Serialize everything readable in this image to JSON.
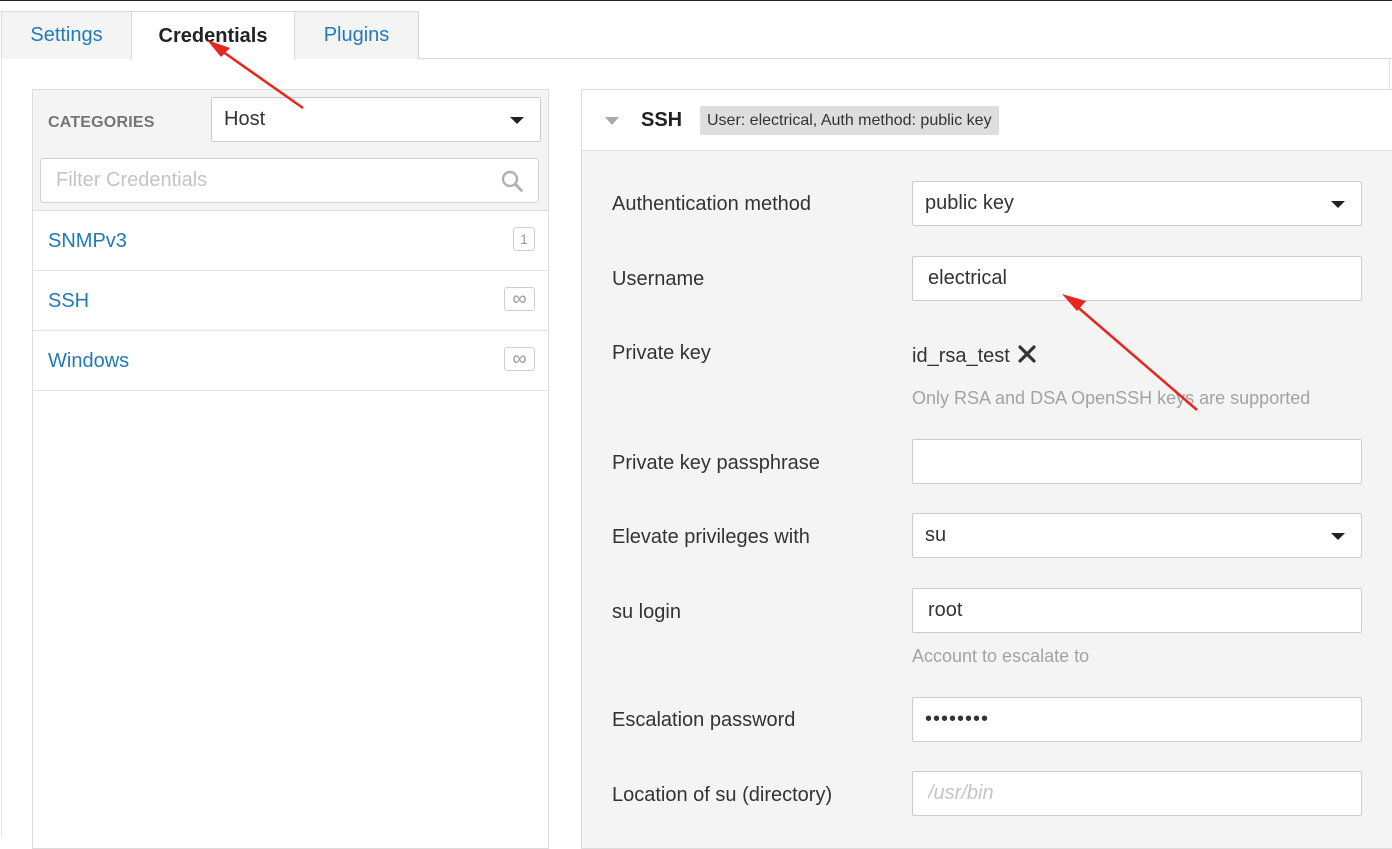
{
  "tabs": [
    {
      "label": "Settings",
      "active": false
    },
    {
      "label": "Credentials",
      "active": true
    },
    {
      "label": "Plugins",
      "active": false
    }
  ],
  "left": {
    "categories_label": "CATEGORIES",
    "category_value": "Host",
    "filter_placeholder": "Filter Credentials",
    "items": [
      {
        "name": "SNMPv3",
        "count": "1"
      },
      {
        "name": "SSH",
        "count": "∞"
      },
      {
        "name": "Windows",
        "count": "∞"
      }
    ]
  },
  "ssh": {
    "title": "SSH",
    "summary": "User: electrical, Auth method: public key",
    "fields": {
      "auth_method": {
        "label": "Authentication method",
        "value": "public key"
      },
      "username": {
        "label": "Username",
        "value": "electrical"
      },
      "private_key": {
        "label": "Private key",
        "value": "id_rsa_test",
        "help": "Only RSA and DSA OpenSSH keys are supported"
      },
      "passphrase": {
        "label": "Private key passphrase",
        "value": ""
      },
      "elevate": {
        "label": "Elevate privileges with",
        "value": "su"
      },
      "su_login": {
        "label": "su login",
        "value": "root",
        "help": "Account to escalate to"
      },
      "escalation_password": {
        "label": "Escalation password",
        "value": "••••••••"
      },
      "su_location": {
        "label": "Location of su (directory)",
        "placeholder": "/usr/bin"
      }
    }
  },
  "colors": {
    "link": "#1f7ab8",
    "annotation": "#e8261c",
    "panel_bg": "#f4f4f4"
  }
}
